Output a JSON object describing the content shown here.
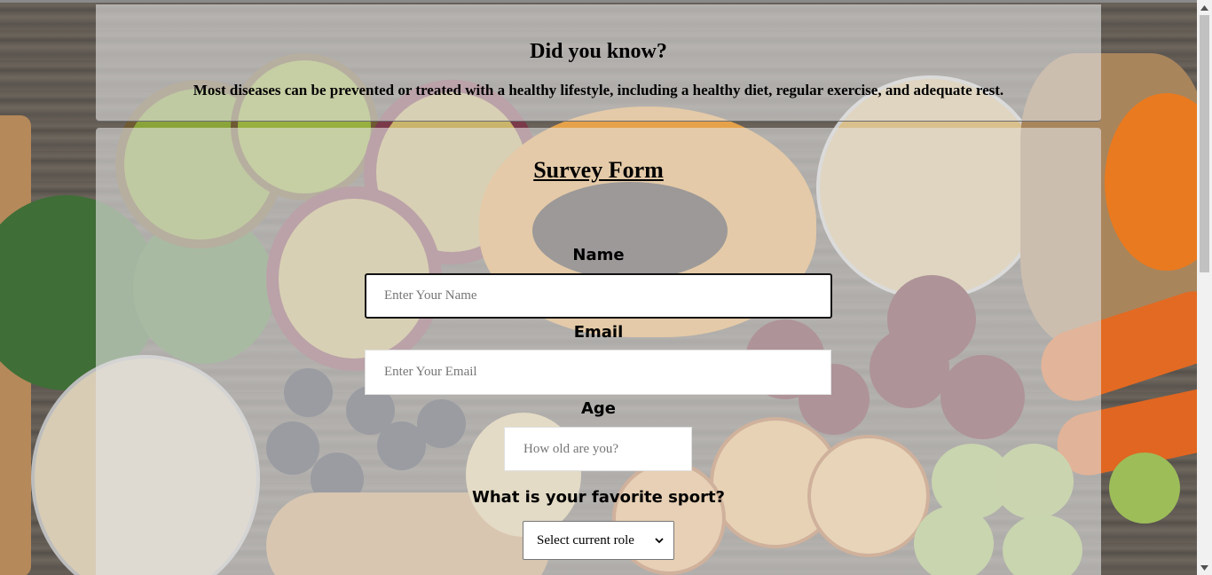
{
  "tip": {
    "title": "Did you know?",
    "text": "Most diseases can be prevented or treated with a healthy lifestyle, including a healthy diet, regular exercise, and adequate rest."
  },
  "form": {
    "title": "Survey Form",
    "name": {
      "label": "Name",
      "placeholder": "Enter Your Name",
      "value": ""
    },
    "email": {
      "label": "Email",
      "placeholder": "Enter Your Email",
      "value": ""
    },
    "age": {
      "label": "Age",
      "placeholder": "How old are you?",
      "value": ""
    },
    "sport": {
      "label": "What is your favorite sport?",
      "selected": "Select current role"
    }
  },
  "icons": {
    "scroll_up": "triangle-up-icon",
    "scroll_down": "triangle-down-icon",
    "dropdown": "chevron-down-icon"
  },
  "colors": {
    "panel_overlay": "#e2e2e2",
    "text": "#000000",
    "focus_border": "#111111",
    "scroll_thumb": "#c1c1c1"
  }
}
